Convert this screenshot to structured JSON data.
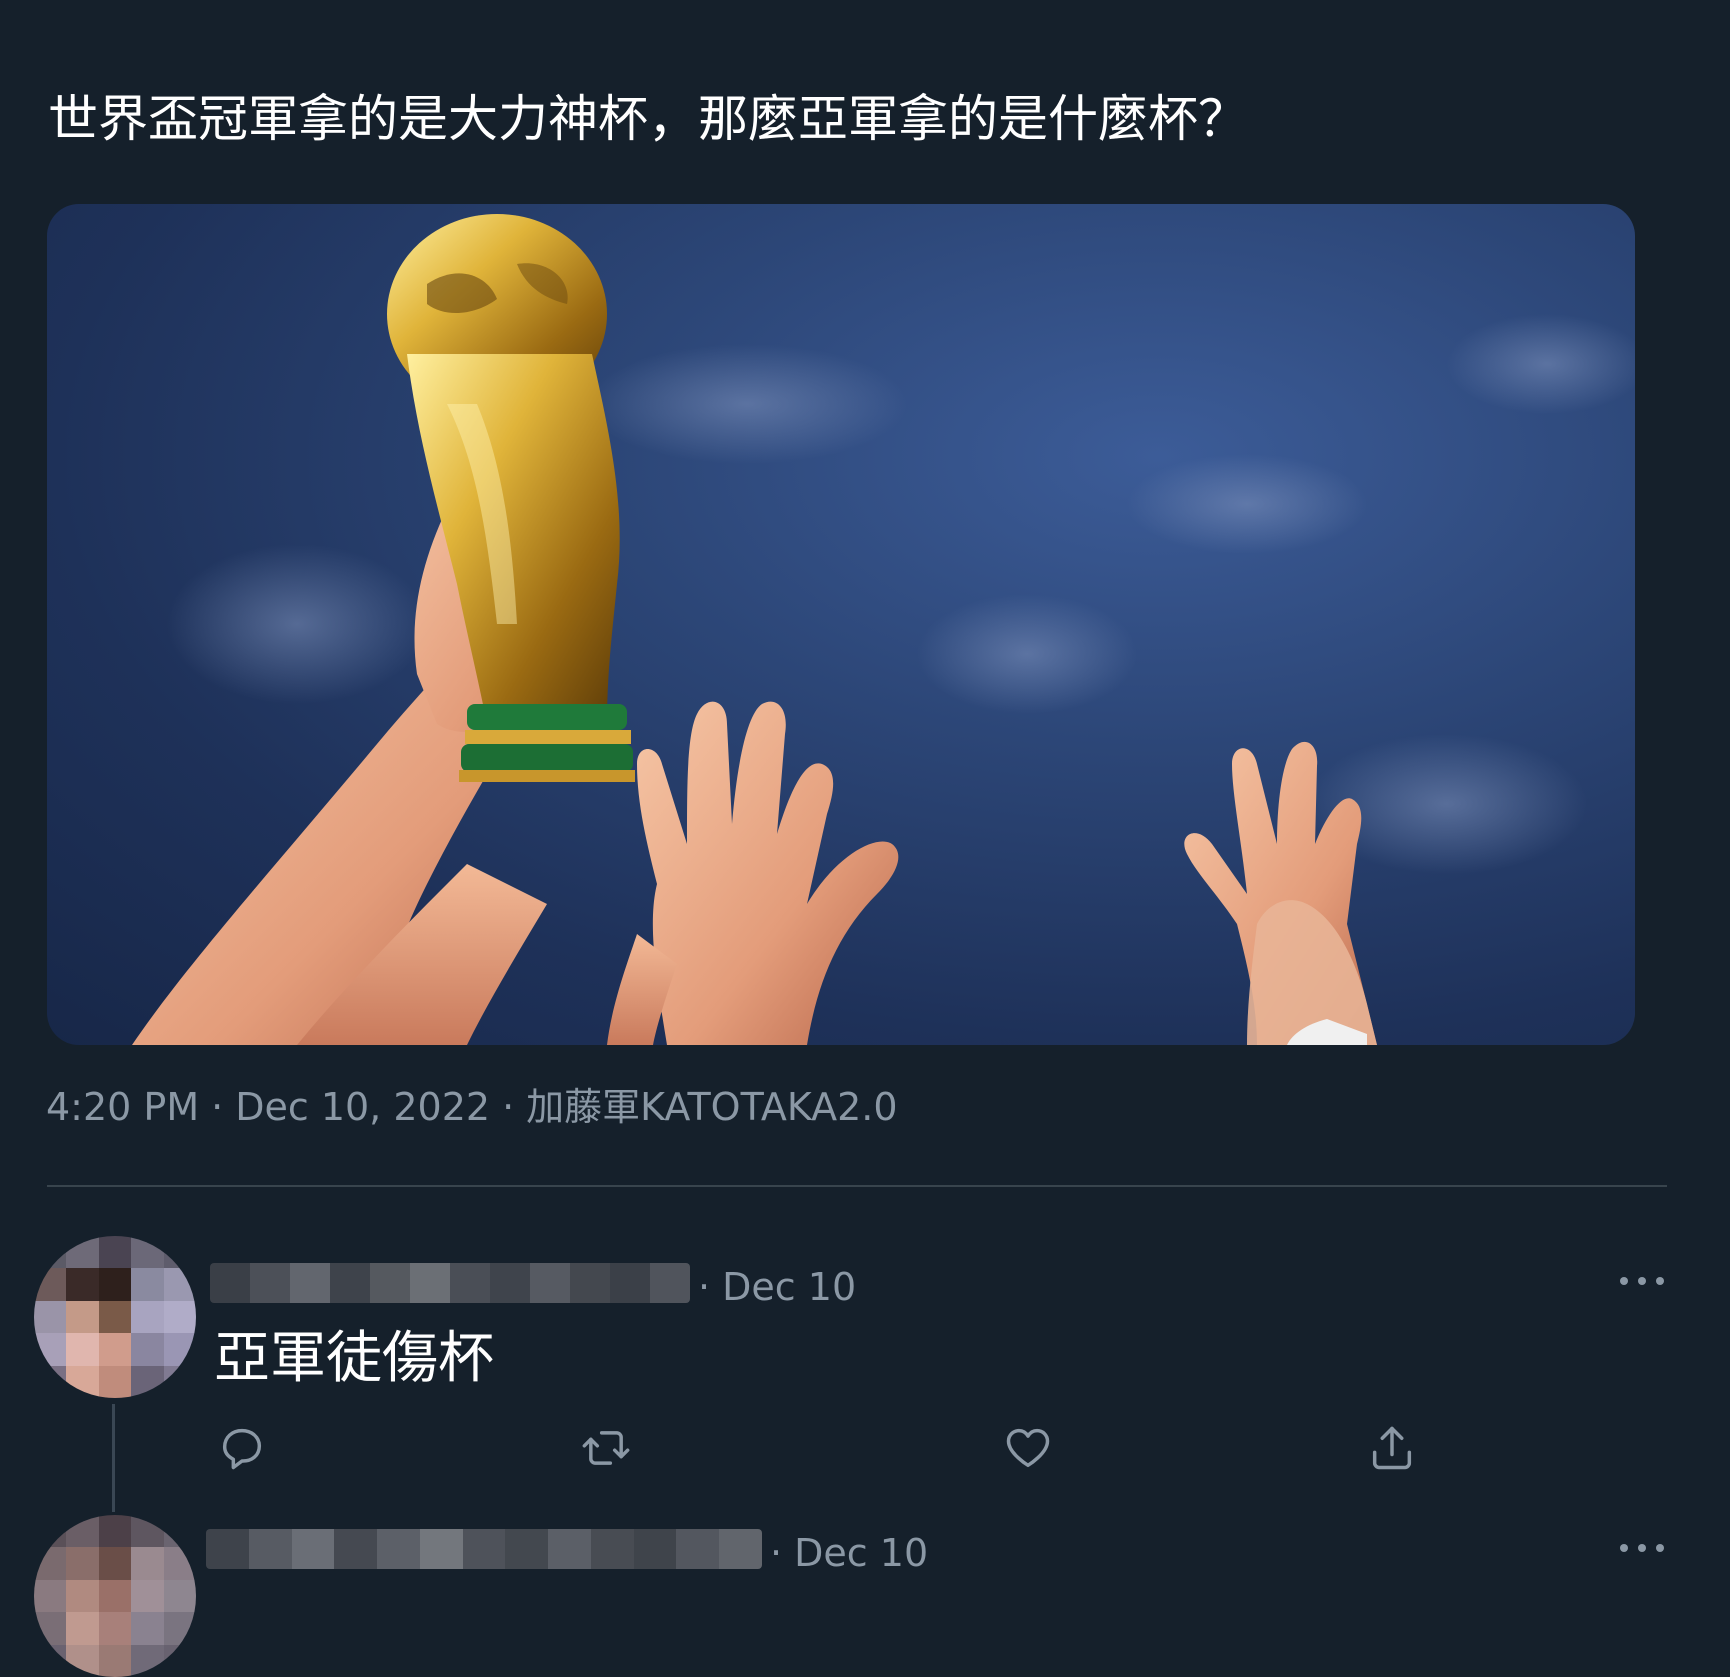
{
  "tweet": {
    "text": "世界盃冠軍拿的是大力神杯，那麼亞軍拿的是什麼杯？",
    "time": "4:20 PM",
    "date": "Dec 10, 2022",
    "source": "加藤軍KATOTAKA2.0",
    "separator": "·",
    "media_icon": "trophy-photo"
  },
  "replies": [
    {
      "author_blurred": true,
      "date": "· Dec 10",
      "text": "亞軍徒傷杯",
      "actions": [
        "reply-icon",
        "retweet-icon",
        "like-icon",
        "share-icon"
      ]
    },
    {
      "author_blurred": true,
      "date": "· Dec 10"
    }
  ],
  "colors": {
    "background": "#15202b",
    "text": "#ffffff",
    "secondary": "#8b98a5",
    "divider": "#38444d"
  }
}
